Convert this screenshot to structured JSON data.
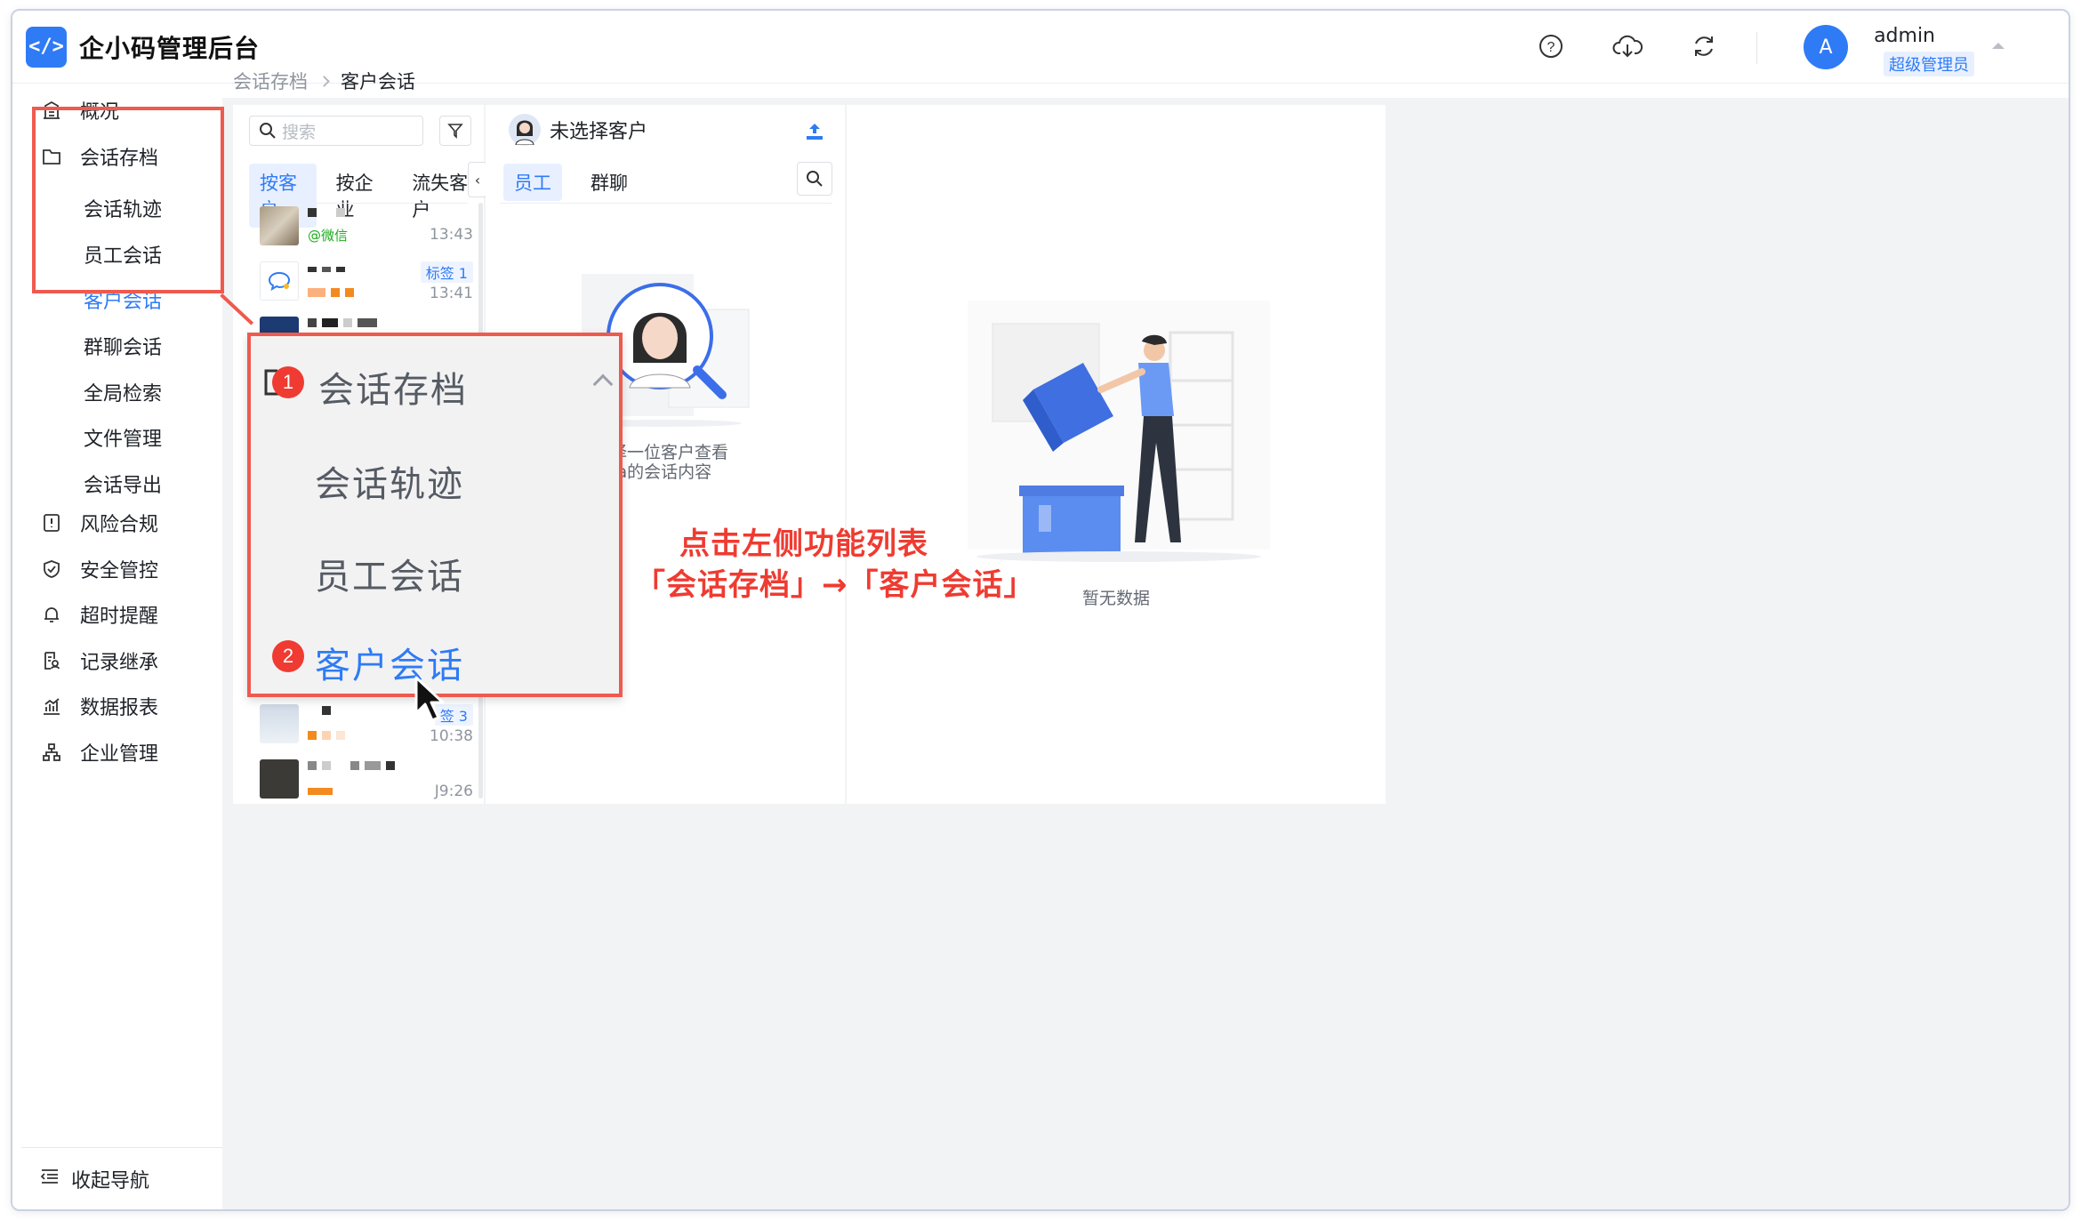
{
  "app": {
    "logo_text": "</>",
    "title": "企小码管理后台"
  },
  "header": {
    "icons": [
      "help-icon",
      "cloud-download-icon",
      "refresh-icon"
    ],
    "avatar_letter": "A",
    "username": "admin",
    "role": "超级管理员"
  },
  "sidebar": {
    "items": [
      {
        "label": "概况",
        "icon": "building-icon"
      },
      {
        "label": "会话存档",
        "icon": "folder-icon",
        "expanded": true
      },
      {
        "label": "会话轨迹"
      },
      {
        "label": "员工会话"
      },
      {
        "label": "客户会话",
        "active": true
      },
      {
        "label": "群聊会话"
      },
      {
        "label": "全局检索"
      },
      {
        "label": "文件管理"
      },
      {
        "label": "会话导出"
      },
      {
        "label": "风险合规",
        "icon": "risk-icon"
      },
      {
        "label": "安全管控",
        "icon": "shield-icon"
      },
      {
        "label": "超时提醒",
        "icon": "bell-icon"
      },
      {
        "label": "记录继承",
        "icon": "inherit-icon"
      },
      {
        "label": "数据报表",
        "icon": "chart-icon"
      },
      {
        "label": "企业管理",
        "icon": "org-icon"
      }
    ],
    "collapse_label": "收起导航"
  },
  "breadcrumb": {
    "parent": "会话存档",
    "current": "客户会话"
  },
  "list_panel": {
    "search_placeholder": "搜索",
    "tabs": [
      "按客户",
      "按企业",
      "流失客户"
    ],
    "active_tab": "按客户",
    "conversations": [
      {
        "sub": "@微信",
        "time": "13:43"
      },
      {
        "tag": "标签 1",
        "time": "13:41",
        "avatar_label": "企业微信"
      },
      {
        "tag": "签 3",
        "time": "10:38"
      },
      {
        "time": "J9:26"
      }
    ]
  },
  "chat_panel": {
    "title": "未选择客户",
    "tabs": [
      "员工",
      "群聊"
    ],
    "active_tab": "员工",
    "empty_line1": "择一位客户查看",
    "empty_line2": "ta的会话内容"
  },
  "detail_panel": {
    "empty_text": "暂无数据"
  },
  "zoom": {
    "items": [
      "会话存档",
      "会话轨迹",
      "员工会话",
      "客户会话"
    ],
    "step1": "1",
    "step2": "2"
  },
  "annotation": {
    "line1": "点击左侧功能列表",
    "line2": "「会话存档」→「客户会话」"
  },
  "colors": {
    "brand": "#2f7bf5",
    "highlight": "#ef5a4f"
  }
}
